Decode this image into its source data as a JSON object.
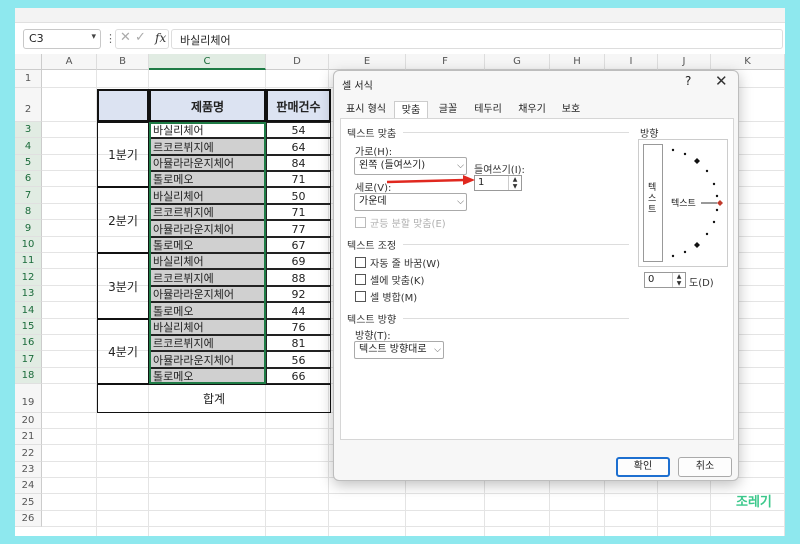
{
  "formula_bar": {
    "name_box": "C3",
    "formula": "바실리체어"
  },
  "columns": [
    "A",
    "B",
    "C",
    "D",
    "E",
    "F",
    "G",
    "H",
    "I",
    "J",
    "K"
  ],
  "rows": [
    "1",
    "2",
    "3",
    "4",
    "5",
    "6",
    "7",
    "8",
    "9",
    "10",
    "11",
    "12",
    "13",
    "14",
    "15",
    "16",
    "17",
    "18",
    "19",
    "20",
    "21",
    "22",
    "23",
    "24",
    "25",
    "26"
  ],
  "table": {
    "header_product": "제품명",
    "header_sales": "판매건수",
    "total_label": "합계",
    "quarters": [
      {
        "label": "1분기",
        "items": [
          {
            "name": "바실리체어",
            "sales": "54"
          },
          {
            "name": "르코르뷔지에",
            "sales": "64"
          },
          {
            "name": "아뮬라라운지체어",
            "sales": "84"
          },
          {
            "name": "톨로메오",
            "sales": "71"
          }
        ]
      },
      {
        "label": "2분기",
        "items": [
          {
            "name": "바실리체어",
            "sales": "50"
          },
          {
            "name": "르코르뷔지에",
            "sales": "71"
          },
          {
            "name": "아뮬라라운지체어",
            "sales": "77"
          },
          {
            "name": "톨로메오",
            "sales": "67"
          }
        ]
      },
      {
        "label": "3분기",
        "items": [
          {
            "name": "바실리체어",
            "sales": "69"
          },
          {
            "name": "르코르뷔지에",
            "sales": "88"
          },
          {
            "name": "아뮬라라운지체어",
            "sales": "92"
          },
          {
            "name": "톨로메오",
            "sales": "44"
          }
        ]
      },
      {
        "label": "4분기",
        "items": [
          {
            "name": "바실리체어",
            "sales": "76"
          },
          {
            "name": "르코르뷔지에",
            "sales": "81"
          },
          {
            "name": "아뮬라라운지체어",
            "sales": "56"
          },
          {
            "name": "톨로메오",
            "sales": "66"
          }
        ]
      }
    ]
  },
  "dialog": {
    "title": "셀 서식",
    "help": "?",
    "close": "✕",
    "tabs": [
      "표시 형식",
      "맞춤",
      "글꼴",
      "테두리",
      "채우기",
      "보호"
    ],
    "active_tab": "맞춤",
    "text_align_section": "텍스트 맞춤",
    "horizontal_label": "가로(H):",
    "horizontal_value": "왼쪽 (들여쓰기)",
    "indent_label": "들여쓰기(I):",
    "indent_value": "1",
    "vertical_label": "세로(V):",
    "vertical_value": "가운데",
    "justify_distributed": "균등 분할 맞춤(E)",
    "text_control_section": "텍스트 조정",
    "wrap_text": "자동 줄 바꿈(W)",
    "shrink_to_fit": "셀에 맞춤(K)",
    "merge_cells": "셀 병합(M)",
    "direction_section": "텍스트 방향",
    "direction_label": "방향(T):",
    "direction_value": "텍스트 방향대로",
    "orientation_section": "방향",
    "orientation_vertical_text": "텍스트",
    "orientation_horizontal_text": "텍스트",
    "degrees_value": "0",
    "degrees_label": "도(D)",
    "ok": "확인",
    "cancel": "취소"
  },
  "watermark": "조레기",
  "colors": {
    "header_fill": "#dce3f2",
    "selected_fill": "#d0d0d0",
    "arrow": "#e0281f",
    "excel_green": "#1e7b45"
  }
}
